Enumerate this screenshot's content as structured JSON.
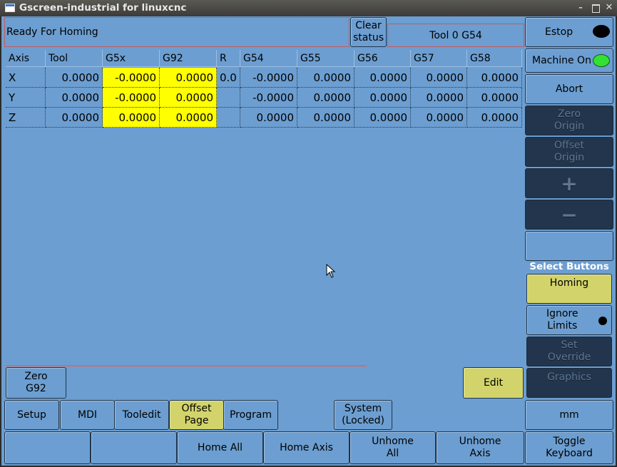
{
  "window": {
    "title": "Gscreen-industrial for linuxcnc"
  },
  "status": {
    "message": "Ready For Homing",
    "clear_label": "Clear\nstatus",
    "tool_info": "Tool 0    G54"
  },
  "right_panel": {
    "estop": "Estop",
    "machine_on": "Machine On",
    "abort": "Abort",
    "zero_origin": "Zero\nOrigin",
    "offset_origin": "Offset\nOrigin",
    "plus": "+",
    "minus": "−",
    "blank": "",
    "section_label": "Select Buttons",
    "homing": "Homing",
    "ignore_limits": "Ignore\nLimits",
    "set_override": "Set\nOverride",
    "graphics": "Graphics",
    "units": "mm",
    "toggle_keyboard": "Toggle\nKeyboard"
  },
  "colors": {
    "background": "#6c9ed1",
    "highlight_yellow": "#ffff00",
    "button_yellow": "#d2d46b",
    "disabled_dark": "#22354c",
    "indicator_green": "#33e133",
    "status_border": "#c85a5a"
  },
  "dro": {
    "headers": [
      "Axis",
      "Tool",
      "G5x",
      "G92",
      "R",
      "G54",
      "G55",
      "G56",
      "G57",
      "G58"
    ],
    "rows": [
      [
        "X",
        "0.0000",
        "-0.0000",
        "0.0000",
        "0.0",
        "-0.0000",
        "0.0000",
        "0.0000",
        "0.0000",
        "0.0000"
      ],
      [
        "Y",
        "0.0000",
        "-0.0000",
        "0.0000",
        "",
        "-0.0000",
        "0.0000",
        "0.0000",
        "0.0000",
        "0.0000"
      ],
      [
        "Z",
        "0.0000",
        "0.0000",
        "0.0000",
        "",
        "0.0000",
        "0.0000",
        "0.0000",
        "0.0000",
        "0.0000"
      ]
    ]
  },
  "page_buttons": {
    "zero_g92": "Zero\nG92",
    "edit": "Edit"
  },
  "mode_bar": {
    "setup": "Setup",
    "mdi": "MDI",
    "tooledit": "Tooledit",
    "offset_page": "Offset\nPage",
    "program": "Program",
    "system": "System\n(Locked)"
  },
  "bottom_bar": {
    "blank1": "",
    "blank2": "",
    "home_all": "Home All",
    "home_axis": "Home Axis",
    "unhome_all": "Unhome\nAll",
    "unhome_axis": "Unhome\nAxis"
  }
}
